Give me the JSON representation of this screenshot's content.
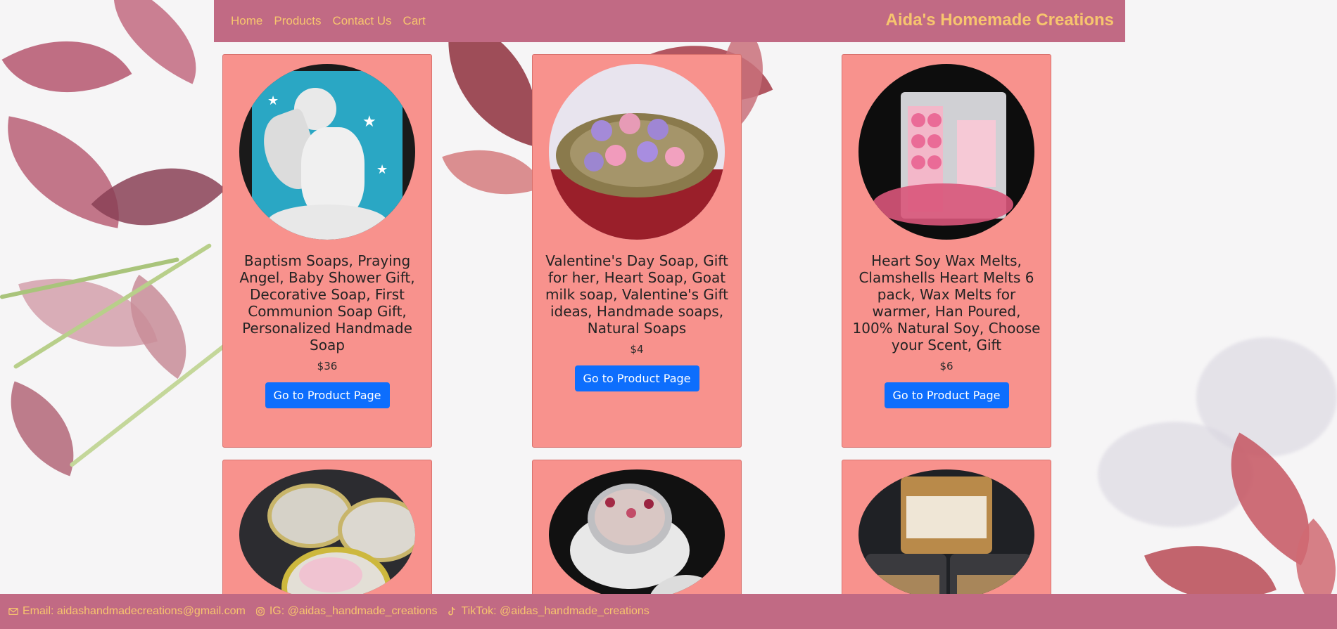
{
  "nav": {
    "links": [
      "Home",
      "Products",
      "Contact Us",
      "Cart"
    ],
    "brand": "Aida's Homemade Creations"
  },
  "products": [
    {
      "title": "Baptism Soaps, Praying Angel, Baby Shower Gift, Decorative Soap, First Communion Soap Gift, Personalized Handmade Soap",
      "price": "$36",
      "button": "Go to Product Page",
      "image_icon": "angel-soap-icon"
    },
    {
      "title": "Valentine's Day Soap, Gift for her, Heart Soap, Goat milk soap, Valentine's Gift ideas, Handmade soaps, Natural Soaps",
      "price": "$4",
      "button": "Go to Product Page",
      "image_icon": "rose-soap-basket-icon"
    },
    {
      "title": "Heart Soy Wax Melts, Clamshells Heart Melts 6 pack, Wax Melts for warmer, Han Poured, 100% Natural Soy, Choose your Scent, Gift",
      "price": "$6",
      "button": "Go to Product Page",
      "image_icon": "wax-melts-icon"
    },
    {
      "image_icon": "candle-tins-icon"
    },
    {
      "image_icon": "rose-candle-warmer-icon"
    },
    {
      "image_icon": "body-butter-jars-icon"
    }
  ],
  "footer": {
    "email": "Email: aidashandmadecreations@gmail.com",
    "instagram": "IG: @aidas_handmade_creations",
    "tiktok": "TikTok: @aidas_handmade_creations"
  },
  "colors": {
    "navbar": "#c16a84",
    "accent_text": "#f7c56e",
    "card": "#f8928d",
    "button": "#0d6efd"
  }
}
